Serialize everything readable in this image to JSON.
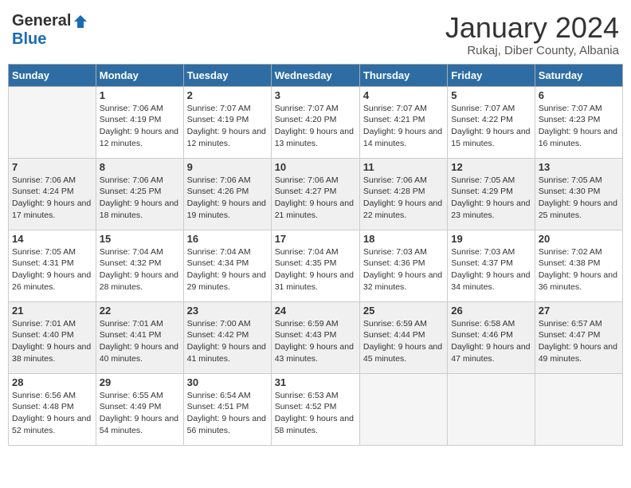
{
  "header": {
    "logo_general": "General",
    "logo_blue": "Blue",
    "month_title": "January 2024",
    "location": "Rukaj, Diber County, Albania"
  },
  "days_of_week": [
    "Sunday",
    "Monday",
    "Tuesday",
    "Wednesday",
    "Thursday",
    "Friday",
    "Saturday"
  ],
  "weeks": [
    [
      {
        "day": "",
        "sunrise": "",
        "sunset": "",
        "daylight": ""
      },
      {
        "day": "1",
        "sunrise": "Sunrise: 7:06 AM",
        "sunset": "Sunset: 4:19 PM",
        "daylight": "Daylight: 9 hours and 12 minutes."
      },
      {
        "day": "2",
        "sunrise": "Sunrise: 7:07 AM",
        "sunset": "Sunset: 4:19 PM",
        "daylight": "Daylight: 9 hours and 12 minutes."
      },
      {
        "day": "3",
        "sunrise": "Sunrise: 7:07 AM",
        "sunset": "Sunset: 4:20 PM",
        "daylight": "Daylight: 9 hours and 13 minutes."
      },
      {
        "day": "4",
        "sunrise": "Sunrise: 7:07 AM",
        "sunset": "Sunset: 4:21 PM",
        "daylight": "Daylight: 9 hours and 14 minutes."
      },
      {
        "day": "5",
        "sunrise": "Sunrise: 7:07 AM",
        "sunset": "Sunset: 4:22 PM",
        "daylight": "Daylight: 9 hours and 15 minutes."
      },
      {
        "day": "6",
        "sunrise": "Sunrise: 7:07 AM",
        "sunset": "Sunset: 4:23 PM",
        "daylight": "Daylight: 9 hours and 16 minutes."
      }
    ],
    [
      {
        "day": "7",
        "sunrise": "Sunrise: 7:06 AM",
        "sunset": "Sunset: 4:24 PM",
        "daylight": "Daylight: 9 hours and 17 minutes."
      },
      {
        "day": "8",
        "sunrise": "Sunrise: 7:06 AM",
        "sunset": "Sunset: 4:25 PM",
        "daylight": "Daylight: 9 hours and 18 minutes."
      },
      {
        "day": "9",
        "sunrise": "Sunrise: 7:06 AM",
        "sunset": "Sunset: 4:26 PM",
        "daylight": "Daylight: 9 hours and 19 minutes."
      },
      {
        "day": "10",
        "sunrise": "Sunrise: 7:06 AM",
        "sunset": "Sunset: 4:27 PM",
        "daylight": "Daylight: 9 hours and 21 minutes."
      },
      {
        "day": "11",
        "sunrise": "Sunrise: 7:06 AM",
        "sunset": "Sunset: 4:28 PM",
        "daylight": "Daylight: 9 hours and 22 minutes."
      },
      {
        "day": "12",
        "sunrise": "Sunrise: 7:05 AM",
        "sunset": "Sunset: 4:29 PM",
        "daylight": "Daylight: 9 hours and 23 minutes."
      },
      {
        "day": "13",
        "sunrise": "Sunrise: 7:05 AM",
        "sunset": "Sunset: 4:30 PM",
        "daylight": "Daylight: 9 hours and 25 minutes."
      }
    ],
    [
      {
        "day": "14",
        "sunrise": "Sunrise: 7:05 AM",
        "sunset": "Sunset: 4:31 PM",
        "daylight": "Daylight: 9 hours and 26 minutes."
      },
      {
        "day": "15",
        "sunrise": "Sunrise: 7:04 AM",
        "sunset": "Sunset: 4:32 PM",
        "daylight": "Daylight: 9 hours and 28 minutes."
      },
      {
        "day": "16",
        "sunrise": "Sunrise: 7:04 AM",
        "sunset": "Sunset: 4:34 PM",
        "daylight": "Daylight: 9 hours and 29 minutes."
      },
      {
        "day": "17",
        "sunrise": "Sunrise: 7:04 AM",
        "sunset": "Sunset: 4:35 PM",
        "daylight": "Daylight: 9 hours and 31 minutes."
      },
      {
        "day": "18",
        "sunrise": "Sunrise: 7:03 AM",
        "sunset": "Sunset: 4:36 PM",
        "daylight": "Daylight: 9 hours and 32 minutes."
      },
      {
        "day": "19",
        "sunrise": "Sunrise: 7:03 AM",
        "sunset": "Sunset: 4:37 PM",
        "daylight": "Daylight: 9 hours and 34 minutes."
      },
      {
        "day": "20",
        "sunrise": "Sunrise: 7:02 AM",
        "sunset": "Sunset: 4:38 PM",
        "daylight": "Daylight: 9 hours and 36 minutes."
      }
    ],
    [
      {
        "day": "21",
        "sunrise": "Sunrise: 7:01 AM",
        "sunset": "Sunset: 4:40 PM",
        "daylight": "Daylight: 9 hours and 38 minutes."
      },
      {
        "day": "22",
        "sunrise": "Sunrise: 7:01 AM",
        "sunset": "Sunset: 4:41 PM",
        "daylight": "Daylight: 9 hours and 40 minutes."
      },
      {
        "day": "23",
        "sunrise": "Sunrise: 7:00 AM",
        "sunset": "Sunset: 4:42 PM",
        "daylight": "Daylight: 9 hours and 41 minutes."
      },
      {
        "day": "24",
        "sunrise": "Sunrise: 6:59 AM",
        "sunset": "Sunset: 4:43 PM",
        "daylight": "Daylight: 9 hours and 43 minutes."
      },
      {
        "day": "25",
        "sunrise": "Sunrise: 6:59 AM",
        "sunset": "Sunset: 4:44 PM",
        "daylight": "Daylight: 9 hours and 45 minutes."
      },
      {
        "day": "26",
        "sunrise": "Sunrise: 6:58 AM",
        "sunset": "Sunset: 4:46 PM",
        "daylight": "Daylight: 9 hours and 47 minutes."
      },
      {
        "day": "27",
        "sunrise": "Sunrise: 6:57 AM",
        "sunset": "Sunset: 4:47 PM",
        "daylight": "Daylight: 9 hours and 49 minutes."
      }
    ],
    [
      {
        "day": "28",
        "sunrise": "Sunrise: 6:56 AM",
        "sunset": "Sunset: 4:48 PM",
        "daylight": "Daylight: 9 hours and 52 minutes."
      },
      {
        "day": "29",
        "sunrise": "Sunrise: 6:55 AM",
        "sunset": "Sunset: 4:49 PM",
        "daylight": "Daylight: 9 hours and 54 minutes."
      },
      {
        "day": "30",
        "sunrise": "Sunrise: 6:54 AM",
        "sunset": "Sunset: 4:51 PM",
        "daylight": "Daylight: 9 hours and 56 minutes."
      },
      {
        "day": "31",
        "sunrise": "Sunrise: 6:53 AM",
        "sunset": "Sunset: 4:52 PM",
        "daylight": "Daylight: 9 hours and 58 minutes."
      },
      {
        "day": "",
        "sunrise": "",
        "sunset": "",
        "daylight": ""
      },
      {
        "day": "",
        "sunrise": "",
        "sunset": "",
        "daylight": ""
      },
      {
        "day": "",
        "sunrise": "",
        "sunset": "",
        "daylight": ""
      }
    ]
  ]
}
